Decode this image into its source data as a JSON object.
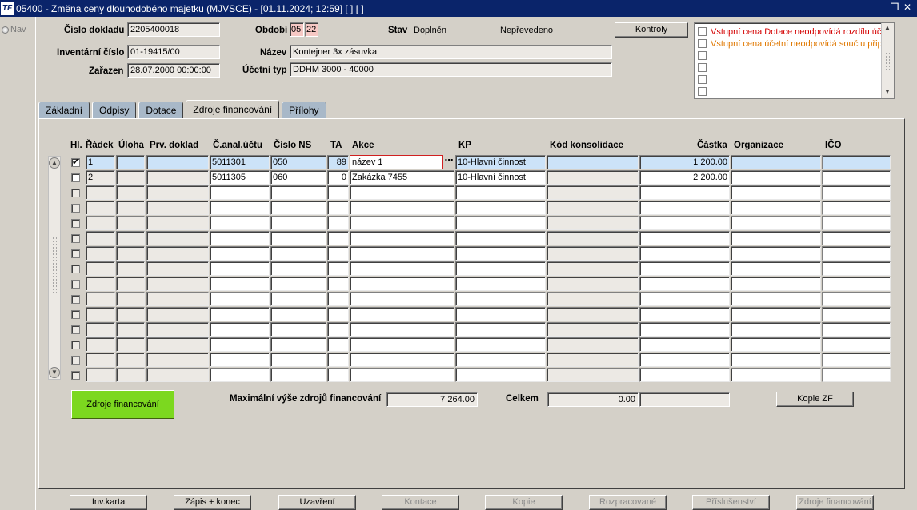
{
  "window": {
    "title": "05400 - Změna ceny dlouhodobého majetku (MJVSCE) - [01.11.2024; 12:59]  [ ]  [ ]",
    "logo": "TF"
  },
  "nav": {
    "label": "Nav"
  },
  "header": {
    "cislo_dokladu": {
      "label": "Číslo dokladu",
      "value": "2205400018"
    },
    "inventarni_cislo": {
      "label": "Inventární číslo",
      "value": "01-19415/00"
    },
    "zarazen": {
      "label": "Zařazen",
      "value": "28.07.2000 00:00:00"
    },
    "obdobi": {
      "label": "Období",
      "value1": "05",
      "value2": "22"
    },
    "stav": {
      "label": "Stav",
      "value": "Doplněn",
      "value2": "Nepřevedeno"
    },
    "nazev": {
      "label": "Název",
      "value": "Kontejner 3x zásuvka"
    },
    "ucetni_typ": {
      "label": "Účetní typ",
      "value": "DDHM 3000 - 40000"
    },
    "kontroly_label": "Kontroly"
  },
  "messages": [
    {
      "text": "Vstupní cena Dotace neodpovídá rozdílu úč",
      "color": "#d40000"
    },
    {
      "text": "Vstupní cena účetní neodpovídá součtu přip",
      "color": "#e07800"
    }
  ],
  "tabs": [
    {
      "label": "Základní"
    },
    {
      "label": "Odpisy"
    },
    {
      "label": "Dotace"
    },
    {
      "label": "Zdroje financování",
      "active": true
    },
    {
      "label": "Přílohy"
    }
  ],
  "table": {
    "headers": {
      "hl": "Hl.",
      "radek": "Řádek",
      "uloha": "Úloha",
      "prv": "Prv. doklad",
      "canal": "Č.anal.účtu",
      "ns": "Číslo NS",
      "ta": "TA",
      "akce": "Akce",
      "kp": "KP",
      "kod": "Kód konsolidace",
      "castka": "Částka",
      "org": "Organizace",
      "ico": "IČO"
    },
    "rows": [
      {
        "hl": "✔",
        "radek": "1",
        "canal": "5011301",
        "ns": "050",
        "ta": "89",
        "akce": "název 1",
        "kp": "10-Hlavní činnost",
        "castka": "1 200.00"
      },
      {
        "hl": "",
        "radek": "2",
        "canal": "5011305",
        "ns": "060",
        "ta": "0",
        "akce": "Zakázka 7455",
        "kp": "10-Hlavní činnost",
        "castka": "2 200.00"
      }
    ]
  },
  "summary": {
    "green_button": "Zdroje financování",
    "max_label": "Maximální výše zdrojů financování",
    "max_value": "7 264.00",
    "celkem_label": "Celkem",
    "celkem_value": "0.00",
    "kopie_label": "Kopie ZF"
  },
  "bottom_buttons": [
    {
      "label": "Inv.karta",
      "enabled": true
    },
    {
      "label": "Zápis + konec",
      "enabled": true
    },
    {
      "label": "Uzavření",
      "enabled": true
    },
    {
      "label": "Kontace",
      "enabled": false
    },
    {
      "label": "Kopie",
      "enabled": false
    },
    {
      "label": "Rozpracované",
      "enabled": false
    },
    {
      "label": "Příslušenství",
      "enabled": false
    },
    {
      "label": "Zdroje financování",
      "enabled": false
    }
  ]
}
